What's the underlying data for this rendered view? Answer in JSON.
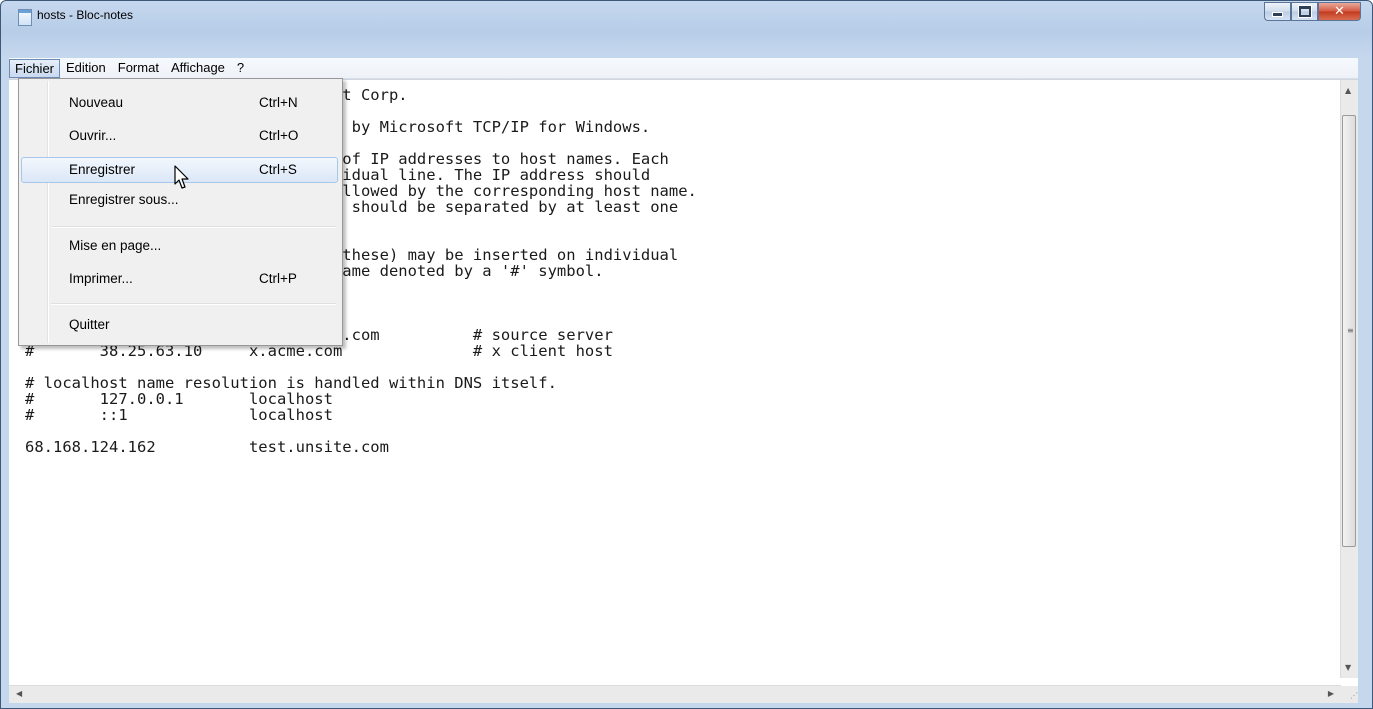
{
  "window": {
    "title": "hosts - Bloc-notes",
    "close_glyph": "✕"
  },
  "menubar": {
    "items": [
      "Fichier",
      "Edition",
      "Format",
      "Affichage",
      "?"
    ]
  },
  "file_menu": {
    "items": [
      {
        "label": "Nouveau",
        "shortcut": "Ctrl+N"
      },
      {
        "label": "Ouvrir...",
        "shortcut": "Ctrl+O"
      },
      {
        "label": "Enregistrer",
        "shortcut": "Ctrl+S"
      },
      {
        "label": "Enregistrer sous...",
        "shortcut": ""
      },
      {
        "label": "Mise en page...",
        "shortcut": ""
      },
      {
        "label": "Imprimer...",
        "shortcut": "Ctrl+P"
      },
      {
        "label": "Quitter",
        "shortcut": ""
      }
    ],
    "highlighted": "Enregistrer"
  },
  "editor": {
    "content": "# Copyright (c) 1993-2009 Microsoft Corp.\n#\n# This is a sample HOSTS file used by Microsoft TCP/IP for Windows.\n#\n# This file contains the mappings of IP addresses to host names. Each\n# entry should be kept on an individual line. The IP address should\n# be placed in the first column followed by the corresponding host name.\n# The IP address and the host name should be separated by at least one\n# space.\n#\n# Additionally, comments (such as these) may be inserted on individual\n# lines or following the machine name denoted by a '#' symbol.\n#\n# For example:\n#\n#      102.54.94.97     rhino.acme.com          # source server\n#       38.25.63.10     x.acme.com              # x client host\n\n# localhost name resolution is handled within DNS itself.\n#       127.0.0.1       localhost\n#       ::1             localhost\n\n68.168.124.162          test.unsite.com"
  }
}
